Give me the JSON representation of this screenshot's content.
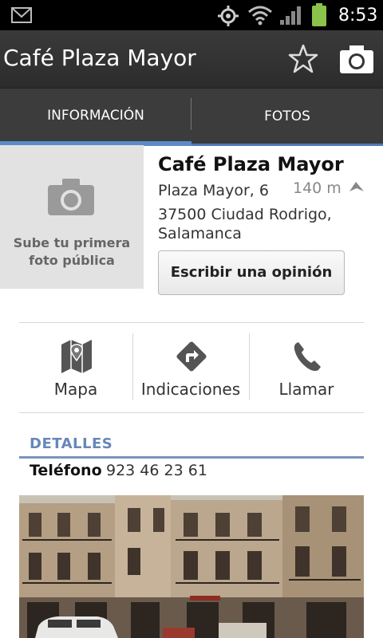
{
  "status_bar": {
    "time": "8:53",
    "icons": [
      "gmail-icon",
      "gps-icon",
      "wifi-icon",
      "signal-icon",
      "battery-icon"
    ],
    "battery_color": "#8bc34a"
  },
  "header": {
    "title": "Café Plaza Mayor",
    "icons": [
      "star-icon",
      "camera-icon"
    ]
  },
  "tabs": [
    {
      "label": "INFORMACIÓN",
      "selected": true
    },
    {
      "label": "FOTOS",
      "selected": false
    }
  ],
  "place": {
    "photo_cta": "Sube tu primera foto pública",
    "name": "Café Plaza Mayor",
    "address_line1": "Plaza Mayor, 6",
    "distance": "140 m",
    "address_line2": "37500 Ciudad Rodrigo, Salamanca",
    "review_button": "Escribir una opinión"
  },
  "actions": [
    {
      "label": "Mapa",
      "icon": "map-icon"
    },
    {
      "label": "Indicaciones",
      "icon": "directions-icon"
    },
    {
      "label": "Llamar",
      "icon": "phone-icon"
    }
  ],
  "details": {
    "heading": "DETALLES",
    "phone_label": "Teléfono",
    "phone_value": "923 46 23 61"
  },
  "colors": {
    "accent": "#5d8ac8",
    "details_heading": "#6787b8",
    "header_bg": "#333333"
  }
}
